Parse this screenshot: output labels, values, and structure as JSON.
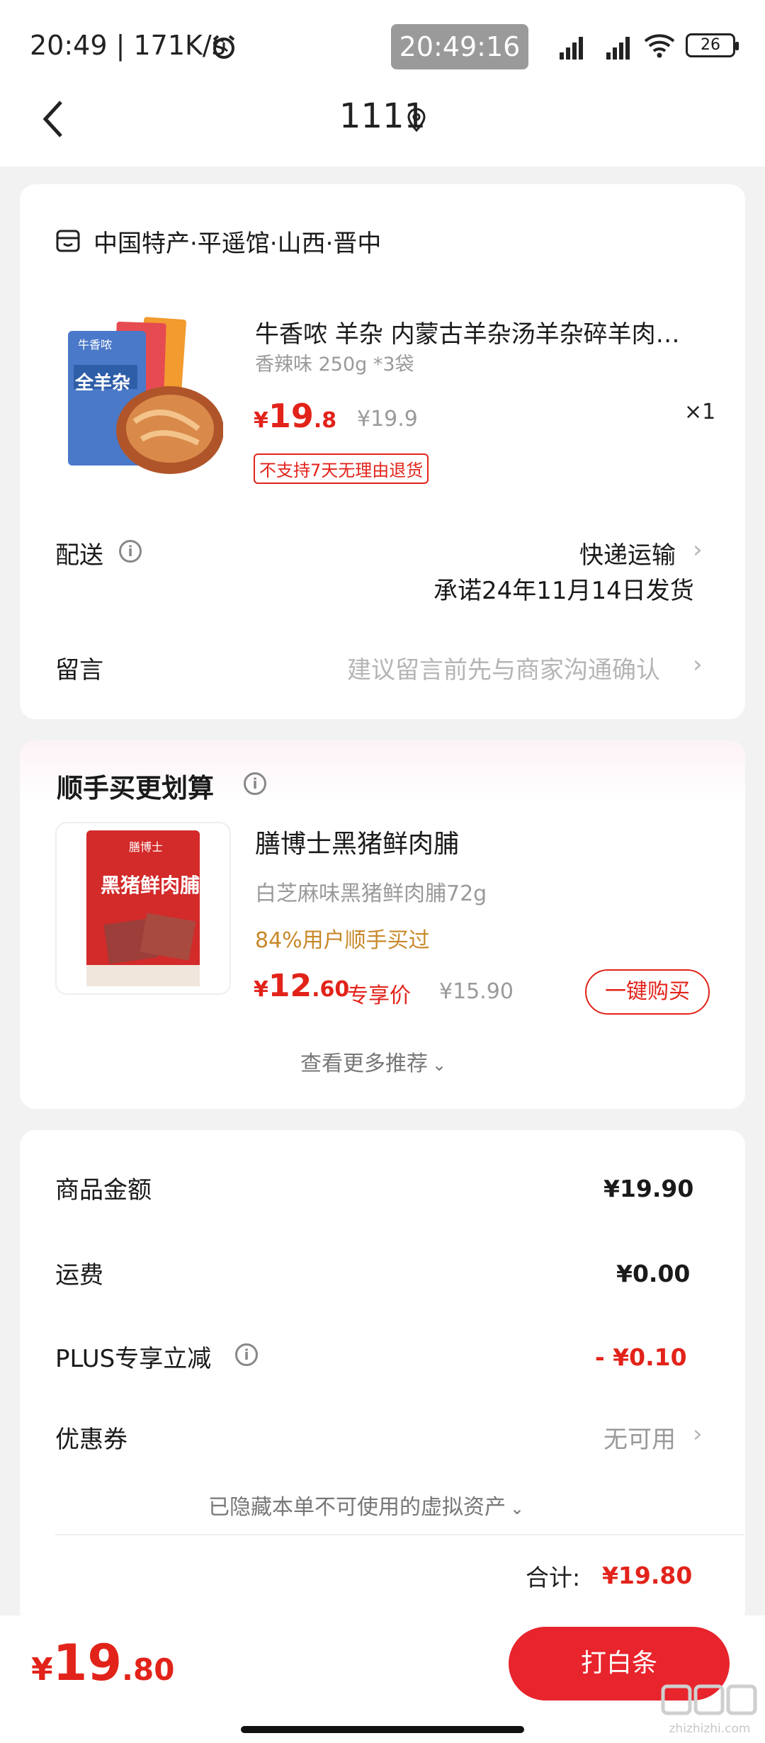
{
  "status_bar": {
    "left_text": "20:49 | 171K/s",
    "center_time": "20:49:16",
    "battery": "26"
  },
  "header": {
    "title": "1111"
  },
  "store": {
    "name": "中国特产·平遥馆·山西·晋中"
  },
  "product": {
    "title": "牛香哝 羊杂 内蒙古羊杂汤羊杂碎羊肉…",
    "spec": "香辣味 250g *3袋",
    "price_symbol": "¥",
    "price_int": "19",
    "price_dec": ".8",
    "original_price": "¥19.9",
    "quantity": "×1",
    "return_tag": "不支持7天无理由退货",
    "image_brand": "牛香哝",
    "image_name": "全羊杂"
  },
  "delivery": {
    "label": "配送",
    "method": "快递运输",
    "promise": "承诺24年11月14日发货"
  },
  "message": {
    "label": "留言",
    "placeholder": "建议留言前先与商家沟通确认"
  },
  "recommend": {
    "section_title": "顺手买更划算",
    "product_title": "膳博士黑猪鲜肉脯",
    "product_spec": "白芝麻味黑猪鲜肉脯72g",
    "bought_text": "84%用户顺手买过",
    "price_symbol": "¥",
    "price_int": "12",
    "price_dec": ".60",
    "exclusive_label": "专享价",
    "original_price": "¥15.90",
    "buy_button": "一键购买",
    "more_link": "查看更多推荐",
    "image_brand": "膳博士",
    "image_name": "黑猪鲜肉脯"
  },
  "summary": {
    "goods_amount_label": "商品金额",
    "goods_amount": "¥19.90",
    "shipping_label": "运费",
    "shipping": "¥0.00",
    "plus_label": "PLUS专享立减",
    "plus_discount": "- ¥0.10",
    "coupon_label": "优惠券",
    "coupon_value": "无可用",
    "hidden_assets": "已隐藏本单不可使用的虚拟资产",
    "total_label": "合计:",
    "total": "¥19.80"
  },
  "bottom_bar": {
    "price_symbol": "¥",
    "price_int": "19",
    "price_dec": ".80",
    "pay_button": "打白条"
  },
  "watermark": {
    "text": "zhizhizhi.com"
  },
  "colors": {
    "accent_red": "#e2231a",
    "bought_orange": "#c8892a"
  }
}
